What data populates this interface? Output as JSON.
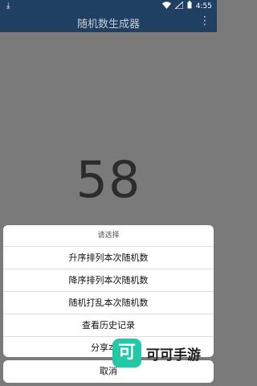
{
  "status_bar": {
    "time": "4:55",
    "icons": [
      "download-icon",
      "wifi-icon",
      "signal-icon",
      "battery-icon"
    ]
  },
  "app_bar": {
    "title": "随机数生成器",
    "menu_icon": "more-vert-icon"
  },
  "main": {
    "number": "58"
  },
  "dialog": {
    "title": "请选择",
    "options": [
      "升序排列本次随机数",
      "降序排列本次随机数",
      "随机打乱本次随机数",
      "查看历史记录",
      "分享本次"
    ],
    "cancel_label": "取消"
  },
  "watermark": {
    "logo_char": "可",
    "text": "可可手游"
  },
  "colors": {
    "app_bar": "#1f3f63",
    "overlay_bg": "#7a7a7a",
    "watermark_accent": "#24c7a6"
  }
}
